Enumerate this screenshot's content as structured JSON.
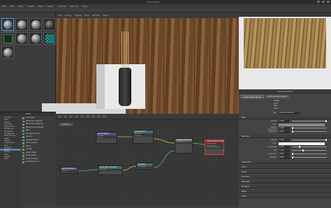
{
  "window": {
    "title": "Hypershade"
  },
  "menubar": [
    "File",
    "Edit",
    "View",
    "Create",
    "Tabs",
    "Graph",
    "Window",
    "Options",
    "Help"
  ],
  "materials": [
    {
      "label": "aiStandardSurface1",
      "style": "light"
    },
    {
      "label": "",
      "style": "light"
    },
    {
      "label": "",
      "style": "light"
    },
    {
      "label": "",
      "style": "dark"
    },
    {
      "label": "",
      "style": "green"
    },
    {
      "label": "",
      "style": "light"
    },
    {
      "label": "",
      "style": "light"
    },
    {
      "label": "",
      "style": "check"
    },
    {
      "label": "",
      "style": "light"
    }
  ],
  "viewport": {
    "menus": [
      "View",
      "Shading",
      "Lighting",
      "Show",
      "Renderer",
      "Panels"
    ]
  },
  "outliner": {
    "title": "Create",
    "categories": [
      "Favorites",
      "Maya",
      "Surface",
      "Volumetric",
      "Displacement",
      "2D Textures",
      "3D Textures",
      "Env Textures",
      "Other Textures",
      "Lights",
      "Utilities",
      "Image Planes",
      "Glow",
      "Rendering",
      "Arnold",
      "Texture",
      "Light",
      "Shader",
      "Utility"
    ],
    "selected_index": 14,
    "items": [
      "Anisotropic",
      "Bifrost Aero Material",
      "Bifrost Foam Material",
      "Bifrost Liquid Material",
      "Blinn",
      "Hair Tube Shader",
      "Lambert",
      "Layered Shader",
      "Ocean Shader",
      "Phong",
      "PhongE",
      "Ramp Shader",
      "Shading Map",
      "Surface Shader",
      "Use Background"
    ]
  },
  "graph": {
    "tab": "Untitled_1",
    "nodes": [
      {
        "title": "place2dTexture",
        "ports": [
          "UV Coord",
          "Out UV",
          "Out UV Filter Size"
        ]
      },
      {
        "title": "wood_floor.tif",
        "ports": [
          "Out Color",
          "Out Alpha",
          "UV Coord"
        ]
      },
      {
        "title": "aiStandardSurface",
        "ports": [
          "Base Color",
          "Specular",
          "Out Color"
        ]
      },
      {
        "title": "aiStandardSurface1SG",
        "ports": [
          "Surface Shader",
          "Volume Shader",
          "Displacement Shader"
        ]
      },
      {
        "title": "aiStandardSurface1",
        "ports": [
          "Out Color"
        ]
      },
      {
        "title": "place2dTexture1",
        "ports": [
          "Out UV"
        ]
      },
      {
        "title": "wood_floor_normal.tif",
        "ports": [
          "Out Color",
          "Out Alpha"
        ]
      },
      {
        "title": "bump2d1",
        "ports": [
          "Bump Value",
          "Out Normal"
        ]
      }
    ]
  },
  "attribute_editor": {
    "title": "Property Editor",
    "tabs": [
      "aiStandardSurface1",
      "aiStandardSurface1SG"
    ],
    "header_rows": [
      "Presets",
      "Show",
      "Hide",
      "Focus"
    ],
    "type_label": "Type",
    "type_value": "aiStandardSurface",
    "sections": {
      "base": "Base",
      "base_rows": [
        {
          "label": "Weight",
          "value": "1.000"
        },
        {
          "label": "Color",
          "value": ""
        },
        {
          "label": "Diffuse Roughness",
          "value": "0.000"
        },
        {
          "label": "Metalness",
          "value": "0.000"
        }
      ],
      "specular": "Specular",
      "subsurface": "Subsurface",
      "transmission": "Transmission",
      "specular_rows": [
        {
          "label": "Weight",
          "value": "1.000"
        },
        {
          "label": "Color",
          "value": ""
        },
        {
          "label": "Roughness",
          "value": "0.200"
        },
        {
          "label": "IOR",
          "value": "1.520"
        },
        {
          "label": "Anisotropy",
          "value": "0.000"
        },
        {
          "label": "Rotation",
          "value": "0.000"
        }
      ],
      "collapsed": [
        "Subsurface",
        "Coat",
        "Sheen",
        "Thin Film",
        "Geometry",
        "Emission",
        "Matte",
        "AOVs",
        "Hardware Texturing",
        "Node Behavior",
        "Extra Attributes"
      ]
    }
  }
}
